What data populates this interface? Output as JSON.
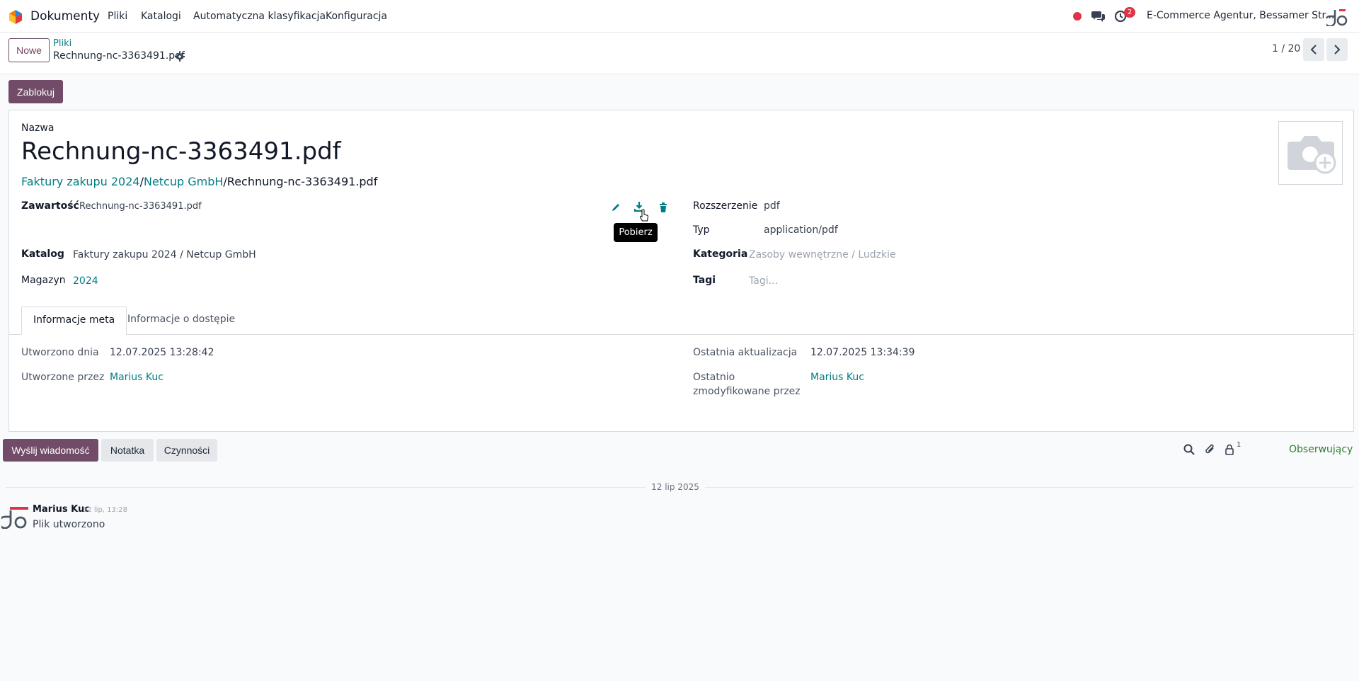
{
  "navbar": {
    "app_name": "Dokumenty",
    "menu": [
      "Pliki",
      "Katalogi",
      "Automatyczna klasyfikacja",
      "Konfiguracja"
    ],
    "activity_badge": "2",
    "company": "E-Commerce Agentur, Bessamer Str..."
  },
  "control": {
    "new_label": "Nowe",
    "breadcrumb_parent": "Pliki",
    "breadcrumb_current": "Rechnung-nc-3363491.pdf",
    "pager": "1 / 20"
  },
  "actions": {
    "lock_label": "Zablokuj"
  },
  "form": {
    "name_label": "Nazwa",
    "title": "Rechnung-nc-3363491.pdf",
    "path": {
      "segment1": "Faktury zakupu 2024",
      "sep": "/",
      "segment2": "Netcup GmbH",
      "file": "Rechnung-nc-3363491.pdf"
    },
    "content_label": "Zawartość",
    "content_value": "Rechnung-nc-3363491.pdf",
    "tooltip": "Pobierz",
    "catalog_label": "Katalog",
    "catalog_value": "Faktury zakupu 2024 / Netcup GmbH",
    "warehouse_label": "Magazyn",
    "warehouse_value": "2024",
    "extension_label": "Rozszerzenie",
    "extension_value": "pdf",
    "type_label": "Typ",
    "type_value": "application/pdf",
    "category_label": "Kategoria",
    "category_placeholder": "Zasoby wewnętrzne / Ludzkie",
    "tags_label": "Tagi",
    "tags_placeholder": "Tagi..."
  },
  "tabs": [
    "Informacje meta",
    "Informacje o dostępie"
  ],
  "meta": {
    "created_on_label": "Utworzono dnia",
    "created_on_value": "12.07.2025 13:28:42",
    "created_by_label": "Utworzone przez",
    "created_by_value": "Marius Kuc",
    "updated_on_label": "Ostatnia aktualizacja",
    "updated_on_value": "12.07.2025 13:34:39",
    "modified_by_label_1": "Ostatnio",
    "modified_by_label_2": "zmodyfikowane przez",
    "modified_by_value": "Marius Kuc"
  },
  "chatter": {
    "send_label": "Wyślij wiadomość",
    "note_label": "Notatka",
    "activities_label": "Czynności",
    "followers_count": "1",
    "following_label": "Obserwujący",
    "date_separator": "12 lip 2025",
    "message_author": "Marius Kuc",
    "message_time": "12 lip, 13:28",
    "message_body": "Plik utworzono"
  },
  "colors": {
    "primary": "#714b67",
    "link": "#017e84",
    "danger": "#dc3545",
    "follow": "#2e7d32"
  }
}
